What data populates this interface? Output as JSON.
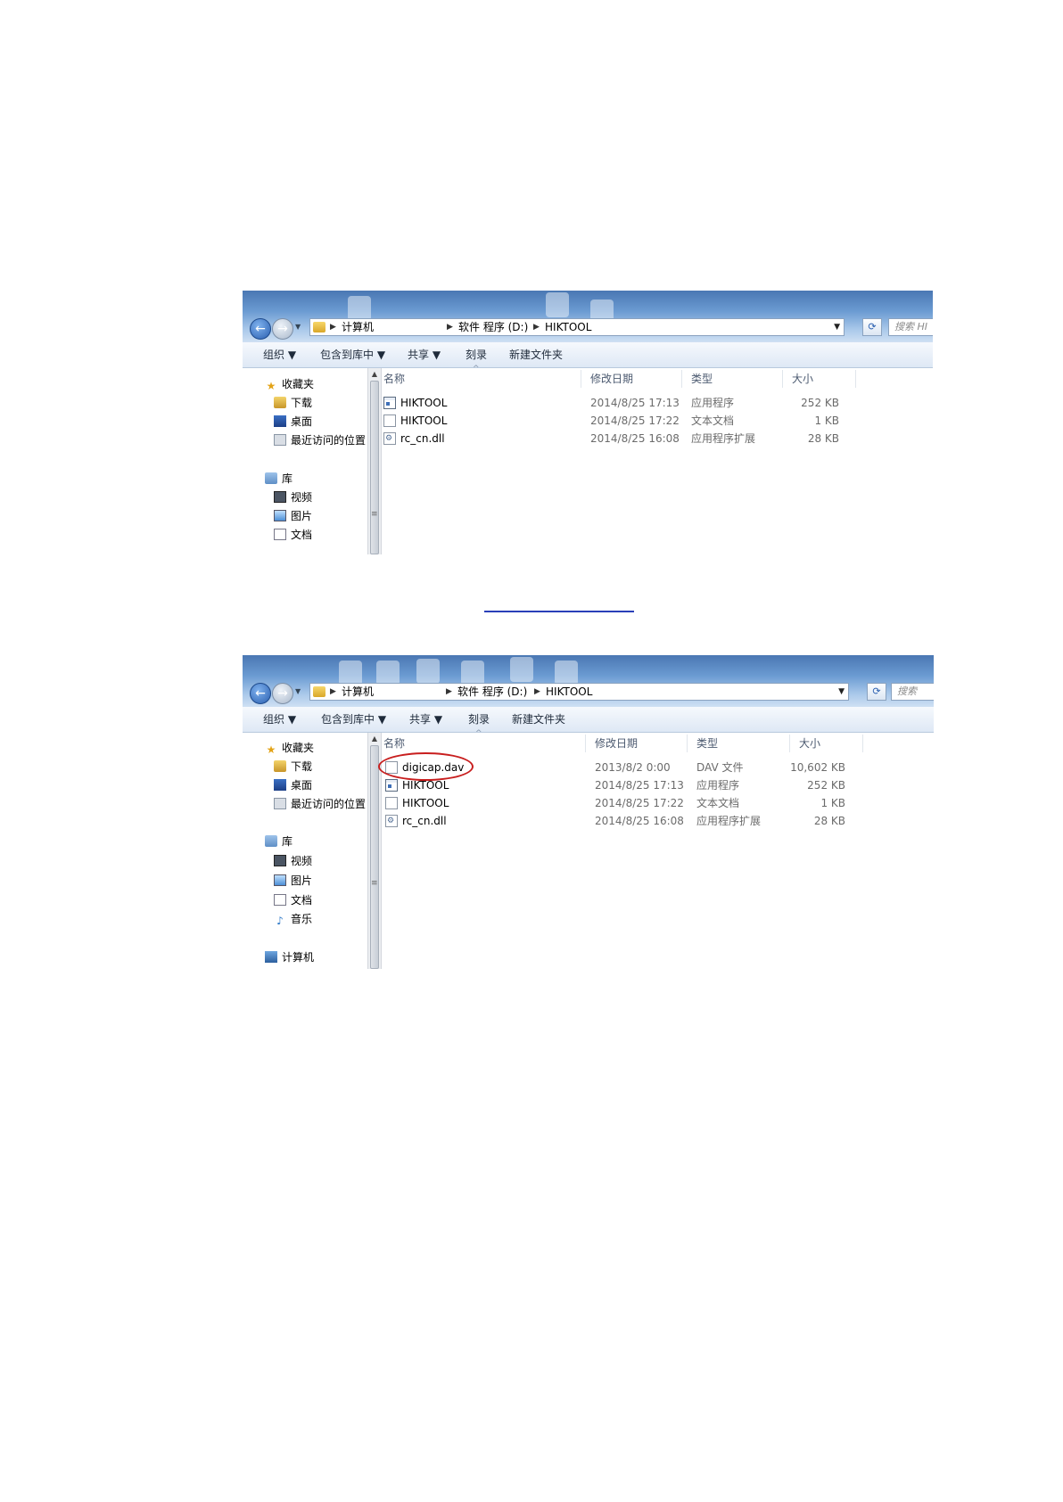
{
  "window1": {
    "breadcrumbs": [
      "计算机",
      "软件 程序 (D:)",
      "HIKTOOL"
    ],
    "search_placeholder": "搜索 HI",
    "toolbar": [
      "组织 ▼",
      "包含到库中 ▼",
      "共享 ▼",
      "刻录",
      "新建文件夹"
    ],
    "nav_items": [
      {
        "icon": "star-icon",
        "label": "收藏夹"
      },
      {
        "icon": "downloads-icon",
        "label": "下载"
      },
      {
        "icon": "desktop-icon",
        "label": "桌面"
      },
      {
        "icon": "recent-places-icon",
        "label": "最近访问的位置"
      },
      {
        "icon": "library-icon",
        "label": "库"
      },
      {
        "icon": "video-icon",
        "label": "视频"
      },
      {
        "icon": "pictures-icon",
        "label": "图片"
      },
      {
        "icon": "documents-icon",
        "label": "文档"
      }
    ],
    "columns": [
      "名称",
      "修改日期",
      "类型",
      "大小"
    ],
    "files": [
      {
        "icon": "exe-icon",
        "name": "HIKTOOL",
        "date": "2014/8/25 17:13",
        "type": "应用程序",
        "size": "252 KB"
      },
      {
        "icon": "txt-icon",
        "name": "HIKTOOL",
        "date": "2014/8/25 17:22",
        "type": "文本文档",
        "size": "1 KB"
      },
      {
        "icon": "dll-icon",
        "name": "rc_cn.dll",
        "date": "2014/8/25 16:08",
        "type": "应用程序扩展",
        "size": "28 KB"
      }
    ]
  },
  "window2": {
    "breadcrumbs": [
      "计算机",
      "软件 程序 (D:)",
      "HIKTOOL"
    ],
    "search_placeholder": "搜索",
    "toolbar": [
      "组织 ▼",
      "包含到库中 ▼",
      "共享 ▼",
      "刻录",
      "新建文件夹"
    ],
    "nav_items": [
      {
        "icon": "star-icon",
        "label": "收藏夹"
      },
      {
        "icon": "downloads-icon",
        "label": "下载"
      },
      {
        "icon": "desktop-icon",
        "label": "桌面"
      },
      {
        "icon": "recent-places-icon",
        "label": "最近访问的位置"
      },
      {
        "icon": "library-icon",
        "label": "库"
      },
      {
        "icon": "video-icon",
        "label": "视频"
      },
      {
        "icon": "pictures-icon",
        "label": "图片"
      },
      {
        "icon": "documents-icon",
        "label": "文档"
      },
      {
        "icon": "music-icon",
        "label": "音乐"
      },
      {
        "icon": "computer-icon",
        "label": "计算机"
      }
    ],
    "columns": [
      "名称",
      "修改日期",
      "类型",
      "大小"
    ],
    "files": [
      {
        "icon": "dav-icon",
        "name": "digicap.dav",
        "date": "2013/8/2 0:00",
        "type": "DAV 文件",
        "size": "10,602 KB",
        "highlighted": true
      },
      {
        "icon": "exe-icon",
        "name": "HIKTOOL",
        "date": "2014/8/25 17:13",
        "type": "应用程序",
        "size": "252 KB"
      },
      {
        "icon": "txt-icon",
        "name": "HIKTOOL",
        "date": "2014/8/25 17:22",
        "type": "文本文档",
        "size": "1 KB"
      },
      {
        "icon": "dll-icon",
        "name": "rc_cn.dll",
        "date": "2014/8/25 16:08",
        "type": "应用程序扩展",
        "size": "28 KB"
      }
    ],
    "highlight_color": "#c81e1e"
  },
  "link_color": "#2a3fb8"
}
